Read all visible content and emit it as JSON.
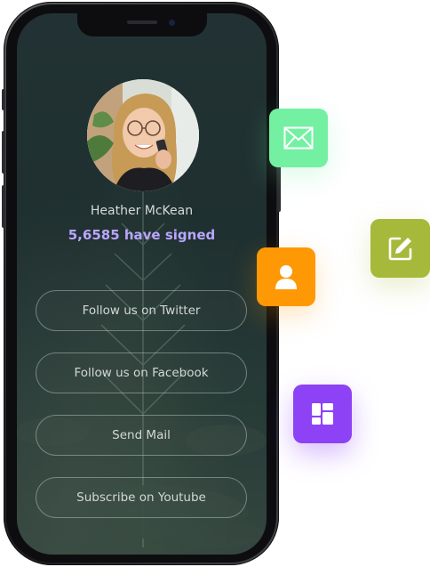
{
  "profile": {
    "name": "Heather McKean",
    "signed_text": "5,6585 have signed"
  },
  "buttons": [
    {
      "label": "Follow us on Twitter"
    },
    {
      "label": "Follow us on Facebook"
    },
    {
      "label": "Send Mail"
    },
    {
      "label": "Subscribe on Youtube"
    }
  ],
  "tiles": [
    {
      "icon": "mail-icon",
      "color": "#74f0a3"
    },
    {
      "icon": "edit-icon",
      "color": "#a7b93b"
    },
    {
      "icon": "user-icon",
      "color": "#ff9805"
    },
    {
      "icon": "dashboard-icon",
      "color": "#8e42f5"
    }
  ],
  "colors": {
    "signed_accent": "#b9a6ff"
  }
}
